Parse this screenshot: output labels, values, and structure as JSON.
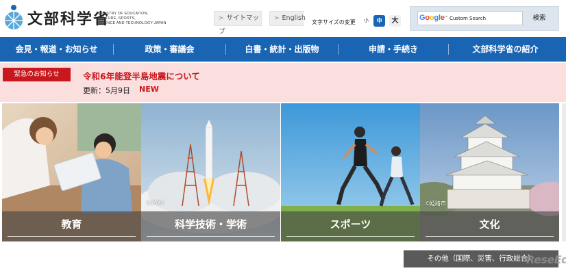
{
  "header": {
    "logo_jp": "文部科学省",
    "logo_en": [
      "MINISTRY OF EDUCATION,",
      "CULTURE, SPORTS,",
      "SCIENCE AND TECHNOLOGY-JAPAN"
    ],
    "sitemap_label": "サイトマップ",
    "english_label": "English",
    "fontsize_label": "文字サイズの変更",
    "fontsize_small": "小",
    "fontsize_mid": "中",
    "fontsize_large": "大",
    "search": {
      "google": "Google",
      "placeholder": "Custom Search",
      "button": "検索"
    }
  },
  "nav": {
    "items": [
      {
        "label": "会見・報道・お知らせ"
      },
      {
        "label": "政策・審議会"
      },
      {
        "label": "白書・統計・出版物"
      },
      {
        "label": "申請・手続き"
      },
      {
        "label": "文部科学省の紹介"
      }
    ]
  },
  "notice": {
    "badge": "緊急のお知らせ",
    "title": "令和6年能登半島地震について",
    "date": "更新：5月9日",
    "new_label": "NEW"
  },
  "tiles": [
    {
      "label": "教育",
      "credit": ""
    },
    {
      "label": "科学技術・学術",
      "credit": "©JAXA"
    },
    {
      "label": "スポーツ",
      "credit": ""
    },
    {
      "label": "文化",
      "credit": "©姫路市"
    }
  ],
  "others_button": "その他（国際、災害、行政総合）",
  "watermark": "ReseEd",
  "colors": {
    "nav_blue": "#1a64b4",
    "notice_bg": "#fbdfdf",
    "notice_red": "#c8171d"
  }
}
